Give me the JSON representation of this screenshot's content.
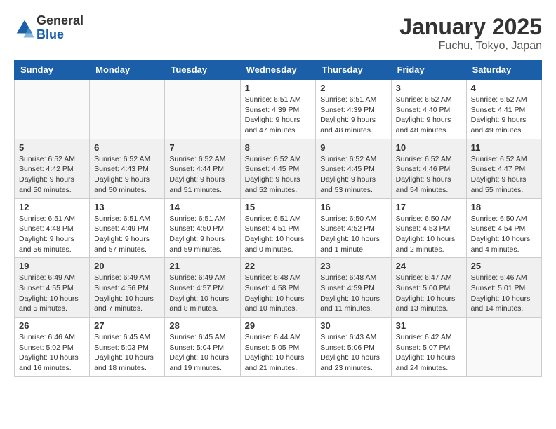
{
  "header": {
    "logo_line1": "General",
    "logo_line2": "Blue",
    "month": "January 2025",
    "location": "Fuchu, Tokyo, Japan"
  },
  "weekdays": [
    "Sunday",
    "Monday",
    "Tuesday",
    "Wednesday",
    "Thursday",
    "Friday",
    "Saturday"
  ],
  "weeks": [
    {
      "shaded": false,
      "days": [
        {
          "num": "",
          "info": ""
        },
        {
          "num": "",
          "info": ""
        },
        {
          "num": "",
          "info": ""
        },
        {
          "num": "1",
          "info": "Sunrise: 6:51 AM\nSunset: 4:39 PM\nDaylight: 9 hours and 47 minutes."
        },
        {
          "num": "2",
          "info": "Sunrise: 6:51 AM\nSunset: 4:39 PM\nDaylight: 9 hours and 48 minutes."
        },
        {
          "num": "3",
          "info": "Sunrise: 6:52 AM\nSunset: 4:40 PM\nDaylight: 9 hours and 48 minutes."
        },
        {
          "num": "4",
          "info": "Sunrise: 6:52 AM\nSunset: 4:41 PM\nDaylight: 9 hours and 49 minutes."
        }
      ]
    },
    {
      "shaded": true,
      "days": [
        {
          "num": "5",
          "info": "Sunrise: 6:52 AM\nSunset: 4:42 PM\nDaylight: 9 hours and 50 minutes."
        },
        {
          "num": "6",
          "info": "Sunrise: 6:52 AM\nSunset: 4:43 PM\nDaylight: 9 hours and 50 minutes."
        },
        {
          "num": "7",
          "info": "Sunrise: 6:52 AM\nSunset: 4:44 PM\nDaylight: 9 hours and 51 minutes."
        },
        {
          "num": "8",
          "info": "Sunrise: 6:52 AM\nSunset: 4:45 PM\nDaylight: 9 hours and 52 minutes."
        },
        {
          "num": "9",
          "info": "Sunrise: 6:52 AM\nSunset: 4:45 PM\nDaylight: 9 hours and 53 minutes."
        },
        {
          "num": "10",
          "info": "Sunrise: 6:52 AM\nSunset: 4:46 PM\nDaylight: 9 hours and 54 minutes."
        },
        {
          "num": "11",
          "info": "Sunrise: 6:52 AM\nSunset: 4:47 PM\nDaylight: 9 hours and 55 minutes."
        }
      ]
    },
    {
      "shaded": false,
      "days": [
        {
          "num": "12",
          "info": "Sunrise: 6:51 AM\nSunset: 4:48 PM\nDaylight: 9 hours and 56 minutes."
        },
        {
          "num": "13",
          "info": "Sunrise: 6:51 AM\nSunset: 4:49 PM\nDaylight: 9 hours and 57 minutes."
        },
        {
          "num": "14",
          "info": "Sunrise: 6:51 AM\nSunset: 4:50 PM\nDaylight: 9 hours and 59 minutes."
        },
        {
          "num": "15",
          "info": "Sunrise: 6:51 AM\nSunset: 4:51 PM\nDaylight: 10 hours and 0 minutes."
        },
        {
          "num": "16",
          "info": "Sunrise: 6:50 AM\nSunset: 4:52 PM\nDaylight: 10 hours and 1 minute."
        },
        {
          "num": "17",
          "info": "Sunrise: 6:50 AM\nSunset: 4:53 PM\nDaylight: 10 hours and 2 minutes."
        },
        {
          "num": "18",
          "info": "Sunrise: 6:50 AM\nSunset: 4:54 PM\nDaylight: 10 hours and 4 minutes."
        }
      ]
    },
    {
      "shaded": true,
      "days": [
        {
          "num": "19",
          "info": "Sunrise: 6:49 AM\nSunset: 4:55 PM\nDaylight: 10 hours and 5 minutes."
        },
        {
          "num": "20",
          "info": "Sunrise: 6:49 AM\nSunset: 4:56 PM\nDaylight: 10 hours and 7 minutes."
        },
        {
          "num": "21",
          "info": "Sunrise: 6:49 AM\nSunset: 4:57 PM\nDaylight: 10 hours and 8 minutes."
        },
        {
          "num": "22",
          "info": "Sunrise: 6:48 AM\nSunset: 4:58 PM\nDaylight: 10 hours and 10 minutes."
        },
        {
          "num": "23",
          "info": "Sunrise: 6:48 AM\nSunset: 4:59 PM\nDaylight: 10 hours and 11 minutes."
        },
        {
          "num": "24",
          "info": "Sunrise: 6:47 AM\nSunset: 5:00 PM\nDaylight: 10 hours and 13 minutes."
        },
        {
          "num": "25",
          "info": "Sunrise: 6:46 AM\nSunset: 5:01 PM\nDaylight: 10 hours and 14 minutes."
        }
      ]
    },
    {
      "shaded": false,
      "days": [
        {
          "num": "26",
          "info": "Sunrise: 6:46 AM\nSunset: 5:02 PM\nDaylight: 10 hours and 16 minutes."
        },
        {
          "num": "27",
          "info": "Sunrise: 6:45 AM\nSunset: 5:03 PM\nDaylight: 10 hours and 18 minutes."
        },
        {
          "num": "28",
          "info": "Sunrise: 6:45 AM\nSunset: 5:04 PM\nDaylight: 10 hours and 19 minutes."
        },
        {
          "num": "29",
          "info": "Sunrise: 6:44 AM\nSunset: 5:05 PM\nDaylight: 10 hours and 21 minutes."
        },
        {
          "num": "30",
          "info": "Sunrise: 6:43 AM\nSunset: 5:06 PM\nDaylight: 10 hours and 23 minutes."
        },
        {
          "num": "31",
          "info": "Sunrise: 6:42 AM\nSunset: 5:07 PM\nDaylight: 10 hours and 24 minutes."
        },
        {
          "num": "",
          "info": ""
        }
      ]
    }
  ]
}
